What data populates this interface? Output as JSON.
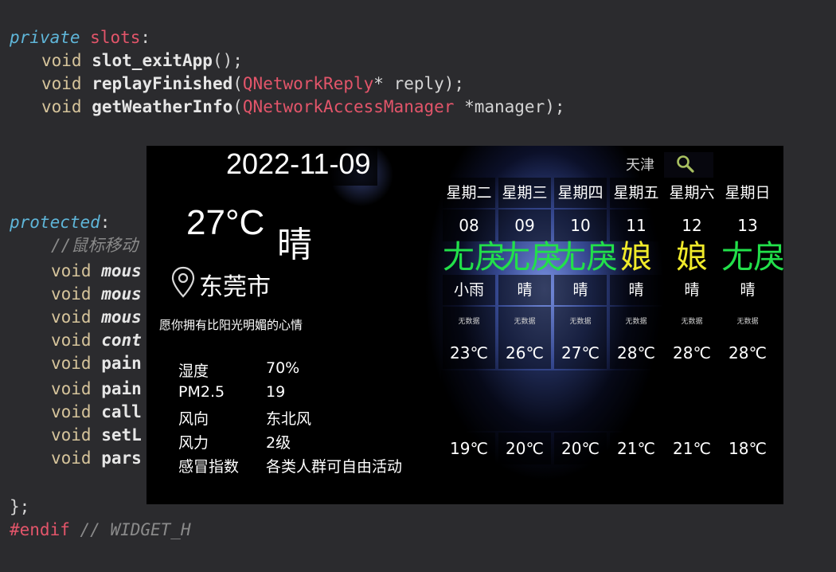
{
  "editor": {
    "line_private": {
      "kw": "private",
      "rest": "slots",
      "colon": ":"
    },
    "line_exit": {
      "type": "void",
      "fn": "slot_exitApp",
      "rest": "();"
    },
    "line_replay": {
      "type": "void",
      "fn": "replayFinished",
      "open": "(",
      "cls": "QNetworkReply",
      "rest": "* reply);"
    },
    "line_weather": {
      "type": "void",
      "fn": "getWeatherInfo",
      "open": "(",
      "cls": "QNetworkAccessManager",
      "rest": " *manager);"
    },
    "line_protected": {
      "kw": "protected",
      "colon": ":"
    },
    "line_comment": "//鼠标移动",
    "hidden_lines": [
      {
        "type": "void",
        "fn": "mous",
        "italic": true
      },
      {
        "type": "void",
        "fn": "mous",
        "italic": true
      },
      {
        "type": "void",
        "fn": "mous",
        "italic": true
      },
      {
        "type": "void",
        "fn": "cont",
        "italic": true
      },
      {
        "type": "void",
        "fn": "pain",
        "italic": false
      },
      {
        "type": "void",
        "fn": "pain",
        "italic": false
      },
      {
        "type": "void",
        "fn": "call",
        "italic": false
      },
      {
        "type": "void",
        "fn": "setL",
        "italic": false
      },
      {
        "type": "void",
        "fn": "pars",
        "italic": false
      }
    ],
    "line_close": "};",
    "line_endif": {
      "directive": "#endif",
      "comment": "// WIDGET_H"
    }
  },
  "weather": {
    "date": "2022-11-09",
    "temperature": "27°C",
    "condition": "晴",
    "city": "东莞市",
    "motto": "愿你拥有比阳光明媚的心情",
    "search_city": "天津",
    "details": [
      {
        "label": "湿度",
        "value": "70%"
      },
      {
        "label": "PM2.5",
        "value": "19"
      },
      {
        "label": "风向",
        "value": "东北风"
      },
      {
        "label": "风力",
        "value": "2级"
      },
      {
        "label": "感冒指数",
        "value": "各类人群可自由活动"
      }
    ],
    "forecast": [
      {
        "week": "星期二",
        "day": "08",
        "icon_text": "尢戾",
        "icon_color": "#22e04a",
        "cond": "小雨",
        "quality": "无数据",
        "high": "23℃",
        "low": "19℃"
      },
      {
        "week": "星期三",
        "day": "09",
        "icon_text": "尢戾",
        "icon_color": "#22e04a",
        "cond": "晴",
        "quality": "无数据",
        "high": "26℃",
        "low": "20℃"
      },
      {
        "week": "星期四",
        "day": "10",
        "icon_text": "尢戾",
        "icon_color": "#22e04a",
        "cond": "晴",
        "quality": "无数据",
        "high": "27℃",
        "low": "20℃"
      },
      {
        "week": "星期五",
        "day": "11",
        "icon_text": "娘",
        "icon_color": "#f0ea2a",
        "cond": "晴",
        "quality": "无数据",
        "high": "28℃",
        "low": "21℃"
      },
      {
        "week": "星期六",
        "day": "12",
        "icon_text": "娘",
        "icon_color": "#f0ea2a",
        "cond": "晴",
        "quality": "无数据",
        "high": "28℃",
        "low": "21℃"
      },
      {
        "week": "星期日",
        "day": "13",
        "icon_text": "尢戾",
        "icon_color": "#22e04a",
        "cond": "晴",
        "quality": "无数据",
        "high": "28℃",
        "low": "18℃"
      }
    ]
  },
  "colors": {
    "editor_bg": "#2b2b2e",
    "keyword": "#5fb6d9",
    "class": "#e3556a",
    "type": "#d6c49b",
    "good_icon": "#22e04a",
    "sun_icon": "#f0ea2a"
  },
  "icons": {
    "location": "location-pin-icon",
    "search": "search-icon"
  }
}
